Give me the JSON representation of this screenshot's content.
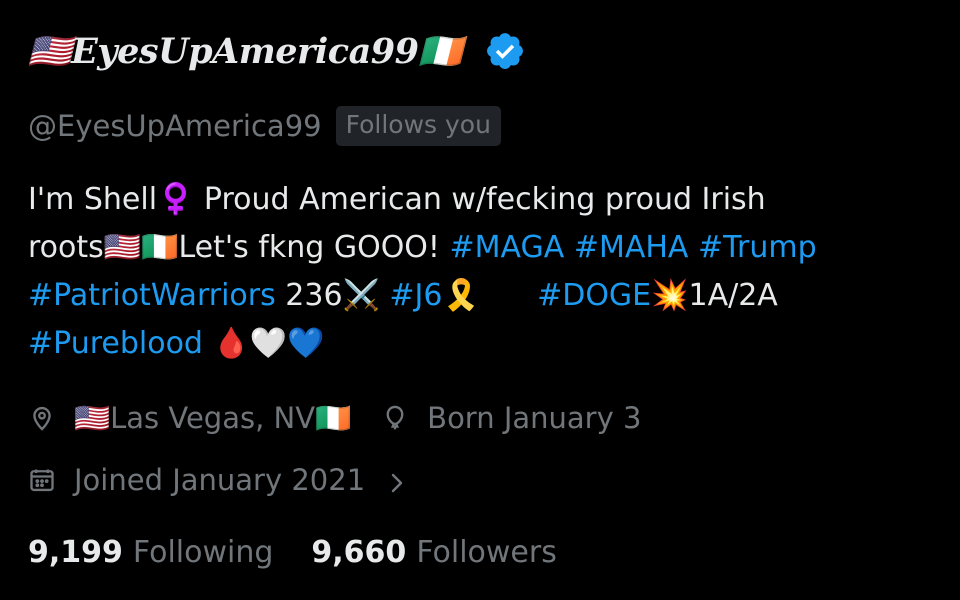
{
  "profile": {
    "display_name": "🇺🇸EyesUpAmerica99🇮🇪",
    "verified": true,
    "handle": "@EyesUpAmerica99",
    "follows_you_badge": "Follows you",
    "bio": {
      "line1": [
        {
          "text": "I'm Shell♀️ Proud American w/fecking proud Irish",
          "type": "text"
        }
      ],
      "line2": [
        {
          "text": "roots🇺🇸🇮🇪Let's fkng GOOO! ",
          "type": "text"
        },
        {
          "text": "#MAGA",
          "type": "hashtag"
        },
        {
          "text": " ",
          "type": "text"
        },
        {
          "text": "#MAHA",
          "type": "hashtag"
        },
        {
          "text": " ",
          "type": "text"
        },
        {
          "text": "#Trump",
          "type": "hashtag"
        }
      ],
      "line3": [
        {
          "text": "#PatriotWarriors",
          "type": "hashtag"
        },
        {
          "text": " 236⚔️ ",
          "type": "text"
        },
        {
          "text": "#J6",
          "type": "hashtag"
        },
        {
          "text": "🎗️      ",
          "type": "text"
        },
        {
          "text": "#DOGE",
          "type": "hashtag"
        },
        {
          "text": "💥1A/2A",
          "type": "text"
        }
      ],
      "line4": [
        {
          "text": "#Pureblood",
          "type": "hashtag"
        },
        {
          "text": " 🩸🤍💙",
          "type": "text"
        }
      ]
    },
    "location": "🇺🇸Las Vegas, NV🇮🇪",
    "birthday": "Born January 3",
    "joined": "Joined January 2021",
    "following_count": "9,199",
    "following_label": "Following",
    "followers_count": "9,660",
    "followers_label": "Followers"
  },
  "colors": {
    "background": "#000000",
    "primary_text": "#e7e9ea",
    "secondary_text": "#71767b",
    "link": "#1d9bf0",
    "verified_badge": "#1d9bf0",
    "badge_background": "#202327"
  },
  "icons": {
    "verified": "verified-badge-icon",
    "location": "location-pin-icon",
    "birthday": "balloon-icon",
    "joined": "calendar-icon",
    "chevron": "chevron-right-icon"
  }
}
